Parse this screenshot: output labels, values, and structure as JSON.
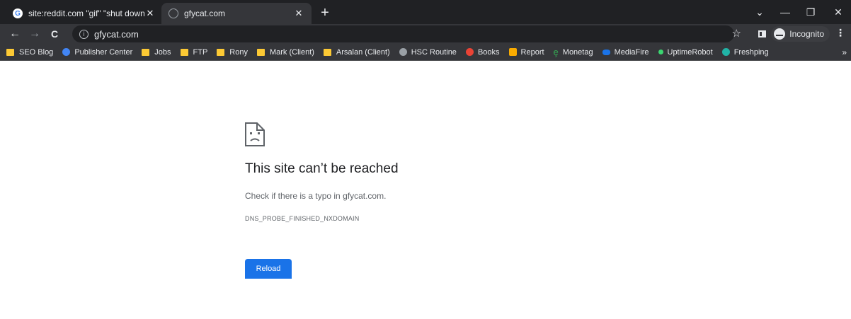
{
  "tabs": [
    {
      "title": "site:reddit.com \"gif\" \"shut down\"",
      "close": "✕",
      "active": false
    },
    {
      "title": "gfycat.com",
      "close": "✕",
      "active": true
    }
  ],
  "new_tab": "+",
  "window_controls": {
    "tab_search": "⌄",
    "minimize": "—",
    "restore": "❐",
    "close": "✕"
  },
  "toolbar": {
    "back": "←",
    "forward": "→",
    "reload": "C",
    "url": "gfycat.com",
    "info_icon": "ⓘ",
    "bookmark_star": "☆",
    "profile_label": "Incognito",
    "menu": "⋮"
  },
  "bookmarks": [
    {
      "label": "SEO Blog",
      "icon": "folder",
      "color": "#fcc934"
    },
    {
      "label": "Publisher Center",
      "icon": "google",
      "color": "#4285f4"
    },
    {
      "label": "Jobs",
      "icon": "folder",
      "color": "#fcc934"
    },
    {
      "label": "FTP",
      "icon": "folder",
      "color": "#fcc934"
    },
    {
      "label": "Rony",
      "icon": "folder",
      "color": "#fcc934"
    },
    {
      "label": "Mark (Client)",
      "icon": "folder",
      "color": "#fcc934"
    },
    {
      "label": "Arsalan (Client)",
      "icon": "folder",
      "color": "#fcc934"
    },
    {
      "label": "HSC Routine",
      "icon": "globe",
      "color": "#9aa0a6"
    },
    {
      "label": "Books",
      "icon": "books",
      "color": "#ea4335"
    },
    {
      "label": "Report",
      "icon": "report",
      "color": "#f9ab00"
    },
    {
      "label": "Monetag",
      "icon": "monetag",
      "color": "#34a853"
    },
    {
      "label": "MediaFire",
      "icon": "mediafire",
      "color": "#1a73e8"
    },
    {
      "label": "UptimeRobot",
      "icon": "uptime",
      "color": "#3bd671"
    },
    {
      "label": "Freshping",
      "icon": "freshping",
      "color": "#21b3a6"
    }
  ],
  "bookmarks_more": "»",
  "error": {
    "title": "This site can’t be reached",
    "detail": "Check if there is a typo in gfycat.com.",
    "code": "DNS_PROBE_FINISHED_NXDOMAIN",
    "button": "Reload"
  }
}
